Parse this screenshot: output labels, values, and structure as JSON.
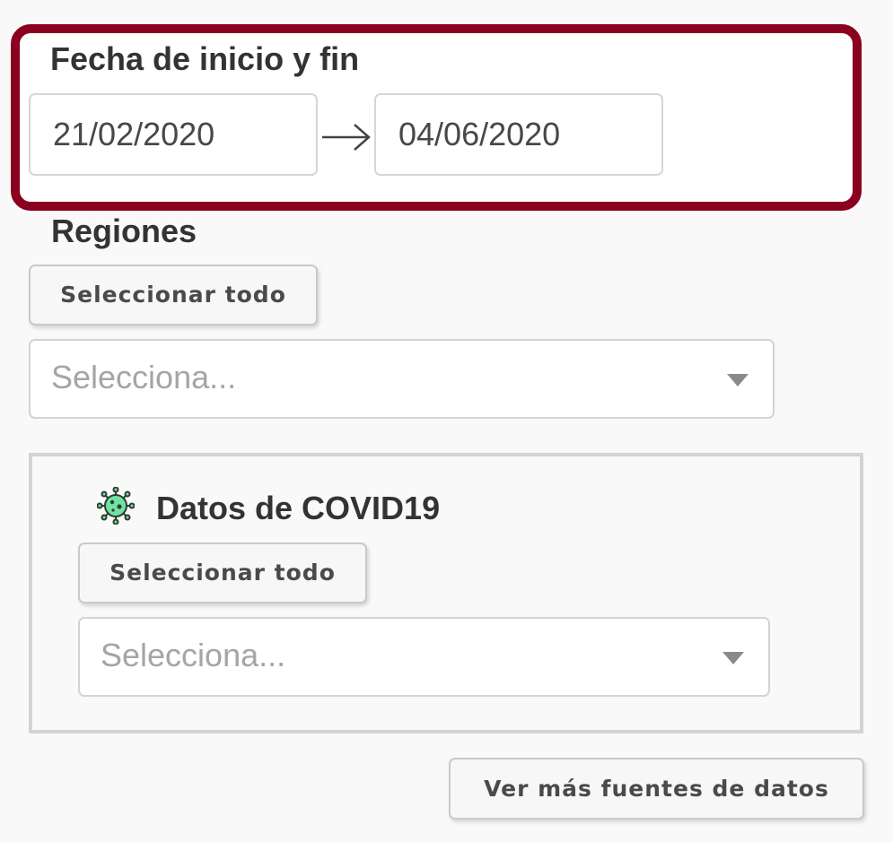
{
  "date_range": {
    "title": "Fecha de inicio y fin",
    "start_date": "21/02/2020",
    "end_date": "04/06/2020",
    "separator_icon": "arrow-right-icon",
    "accent_color": "#8b0020"
  },
  "regions": {
    "title": "Regiones",
    "select_all_label": "Seleccionar todo",
    "placeholder": "Selecciona..."
  },
  "covid": {
    "icon": "virus-icon",
    "icon_color": "#6fe3a0",
    "title": "Datos de COVID19",
    "select_all_label": "Seleccionar todo",
    "placeholder": "Selecciona..."
  },
  "more_sources_label": "Ver más fuentes de datos"
}
